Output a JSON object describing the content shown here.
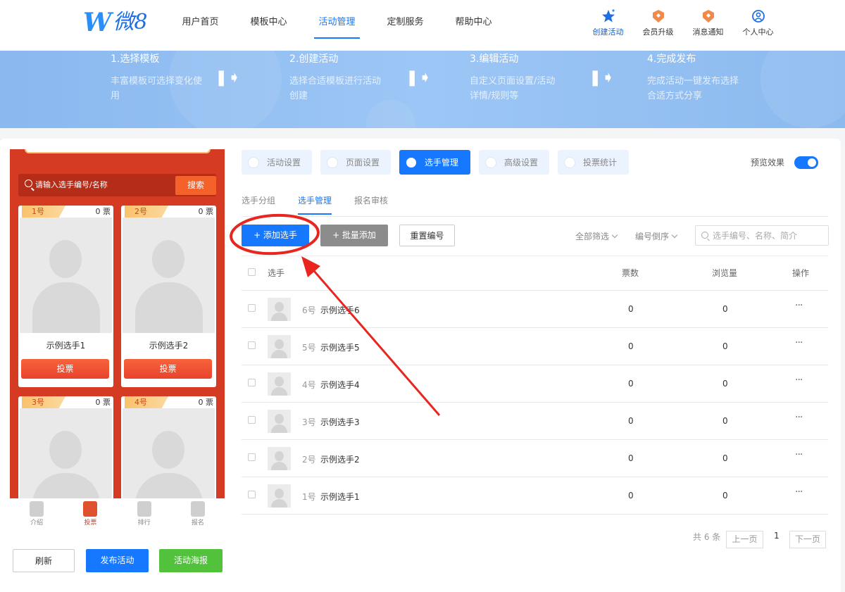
{
  "header": {
    "logo_mark": "W",
    "logo_text": "微8",
    "nav": [
      "用户首页",
      "模板中心",
      "活动管理",
      "定制服务",
      "帮助中心"
    ],
    "actions": [
      {
        "label": "创建活动",
        "icon": "star-icon"
      },
      {
        "label": "会员升级",
        "icon": "member-badge-icon"
      },
      {
        "label": "消息通知",
        "icon": "notification-badge-icon"
      },
      {
        "label": "个人中心",
        "icon": "user-circle-icon"
      }
    ]
  },
  "steps": [
    {
      "title": "1.选择模板",
      "desc": "丰富模板可选择变化使用"
    },
    {
      "title": "2.创建活动",
      "desc": "选择合适模板进行活动创建"
    },
    {
      "title": "3.编辑活动",
      "desc": "自定义页面设置/活动详情/规则等"
    },
    {
      "title": "4.完成发布",
      "desc": "完成活动一键发布选择合适方式分享"
    }
  ],
  "phone": {
    "search_placeholder": "请输入选手编号/名称",
    "search_button": "搜索",
    "cards": [
      {
        "num": "1号",
        "votes": "0 票",
        "name": "示例选手1",
        "vote_btn": "投票"
      },
      {
        "num": "2号",
        "votes": "0 票",
        "name": "示例选手2",
        "vote_btn": "投票"
      },
      {
        "num": "3号",
        "votes": "0 票",
        "name": "",
        "vote_btn": ""
      },
      {
        "num": "4号",
        "votes": "0 票",
        "name": "",
        "vote_btn": ""
      }
    ],
    "bottom_nav": [
      "介绍",
      "投票",
      "排行",
      "报名"
    ]
  },
  "left_buttons": {
    "refresh": "刷新",
    "publish": "发布活动",
    "poster": "活动海报"
  },
  "top_tabs": [
    "活动设置",
    "页面设置",
    "选手管理",
    "高级设置",
    "投票统计"
  ],
  "preview_label": "预览效果",
  "sub_tabs": [
    "选手分组",
    "选手管理",
    "报名审核"
  ],
  "actions": {
    "add": "+ 添加选手",
    "batch": "+ 批量添加",
    "reset": "重置编号"
  },
  "filters": {
    "all": "全部筛选",
    "order": "编号倒序"
  },
  "search_placeholder": "选手编号、名称、简介",
  "table": {
    "headers": [
      "选手",
      "票数",
      "浏览量",
      "操作"
    ],
    "rows": [
      {
        "num": "6号",
        "name": "示例选手6",
        "votes": "0",
        "views": "0",
        "more": "···"
      },
      {
        "num": "5号",
        "name": "示例选手5",
        "votes": "0",
        "views": "0",
        "more": "···"
      },
      {
        "num": "4号",
        "name": "示例选手4",
        "votes": "0",
        "views": "0",
        "more": "···"
      },
      {
        "num": "3号",
        "name": "示例选手3",
        "votes": "0",
        "views": "0",
        "more": "···"
      },
      {
        "num": "2号",
        "name": "示例选手2",
        "votes": "0",
        "views": "0",
        "more": "···"
      },
      {
        "num": "1号",
        "name": "示例选手1",
        "votes": "0",
        "views": "0",
        "more": "···"
      }
    ]
  },
  "pagination": {
    "total": "共 6 条",
    "prev": "上一页",
    "current": "1",
    "next": "下一页"
  },
  "colors": {
    "primary": "#1677ff",
    "phone_bg": "#d53a22",
    "vote_btn": "#f05a34",
    "annotation": "#e8261f",
    "success": "#52c23c"
  }
}
